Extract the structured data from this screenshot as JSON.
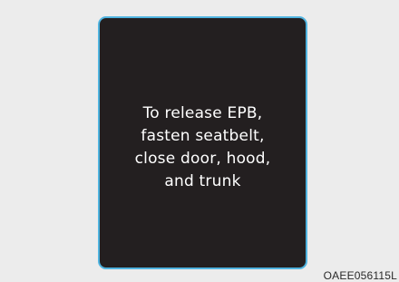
{
  "display": {
    "message_lines": [
      "To release EPB,",
      "fasten seatbelt,",
      "close door, hood,",
      "and trunk"
    ]
  },
  "image_code": "OAEE056115L",
  "colors": {
    "page_background": "#ececec",
    "screen_background": "#231f20",
    "screen_border": "#4fb3df",
    "text": "#ffffff"
  }
}
